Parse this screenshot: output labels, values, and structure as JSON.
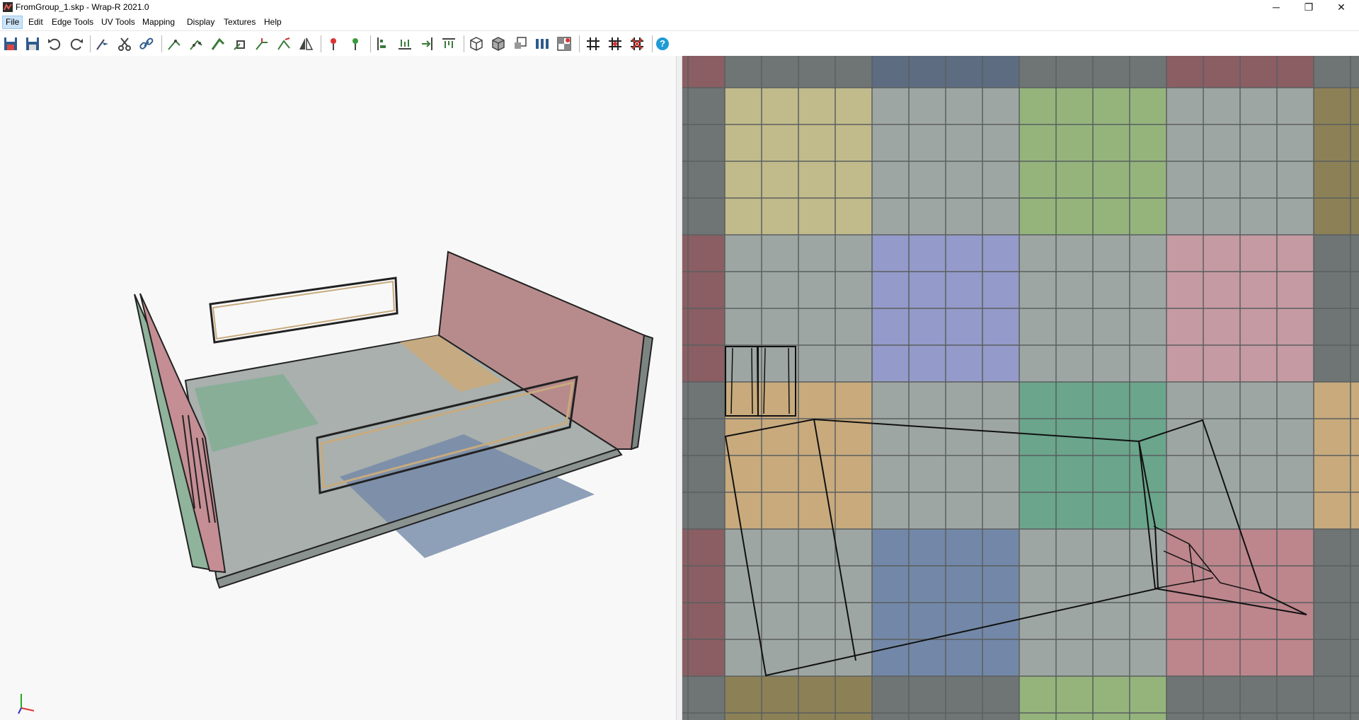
{
  "window": {
    "title": "FromGroup_1.skp - Wrap-R 2021.0",
    "minimize_glyph": "─",
    "restore_glyph": "❐",
    "close_glyph": "✕"
  },
  "menu": [
    "File",
    "Edit",
    "Edge Tools",
    "UV Tools",
    "Mapping",
    "Display",
    "Textures",
    "Help"
  ],
  "toolbar": {
    "icons": [
      "save-icon",
      "save-as-icon",
      "undo-icon",
      "redo-icon",
      "select-edge-icon",
      "cut-seam-icon",
      "link-seam-icon",
      "unwrap-icon",
      "unwrap-selected-icon",
      "relax-icon",
      "pin-icon",
      "straighten-icon",
      "stitch-icon",
      "mirror-icon",
      "pin-red-icon",
      "pin-green-icon",
      "align-left-icon",
      "align-bottom-icon",
      "align-right-icon",
      "align-top-icon",
      "box-map-icon",
      "cube-map-icon",
      "planar-map-icon",
      "distribute-icon",
      "checker-icon",
      "grid-icon",
      "grid-fit-icon",
      "grid-remove-icon",
      "help-icon"
    ],
    "help_glyph": "?"
  },
  "colors": {
    "red": "#8a5e63",
    "yellow": "#c1bb8c",
    "blue_top": "#5d6c81",
    "green": "#94b47c",
    "gray": "#9ea6a3",
    "lavender": "#949ac9",
    "pink": "#c59aa2",
    "orange": "#c8aa7d",
    "teal": "#6aa58c",
    "slate": "#7388a8",
    "rose": "#bd858c",
    "border_dark": "#6f7474",
    "olive": "#8c8156"
  }
}
